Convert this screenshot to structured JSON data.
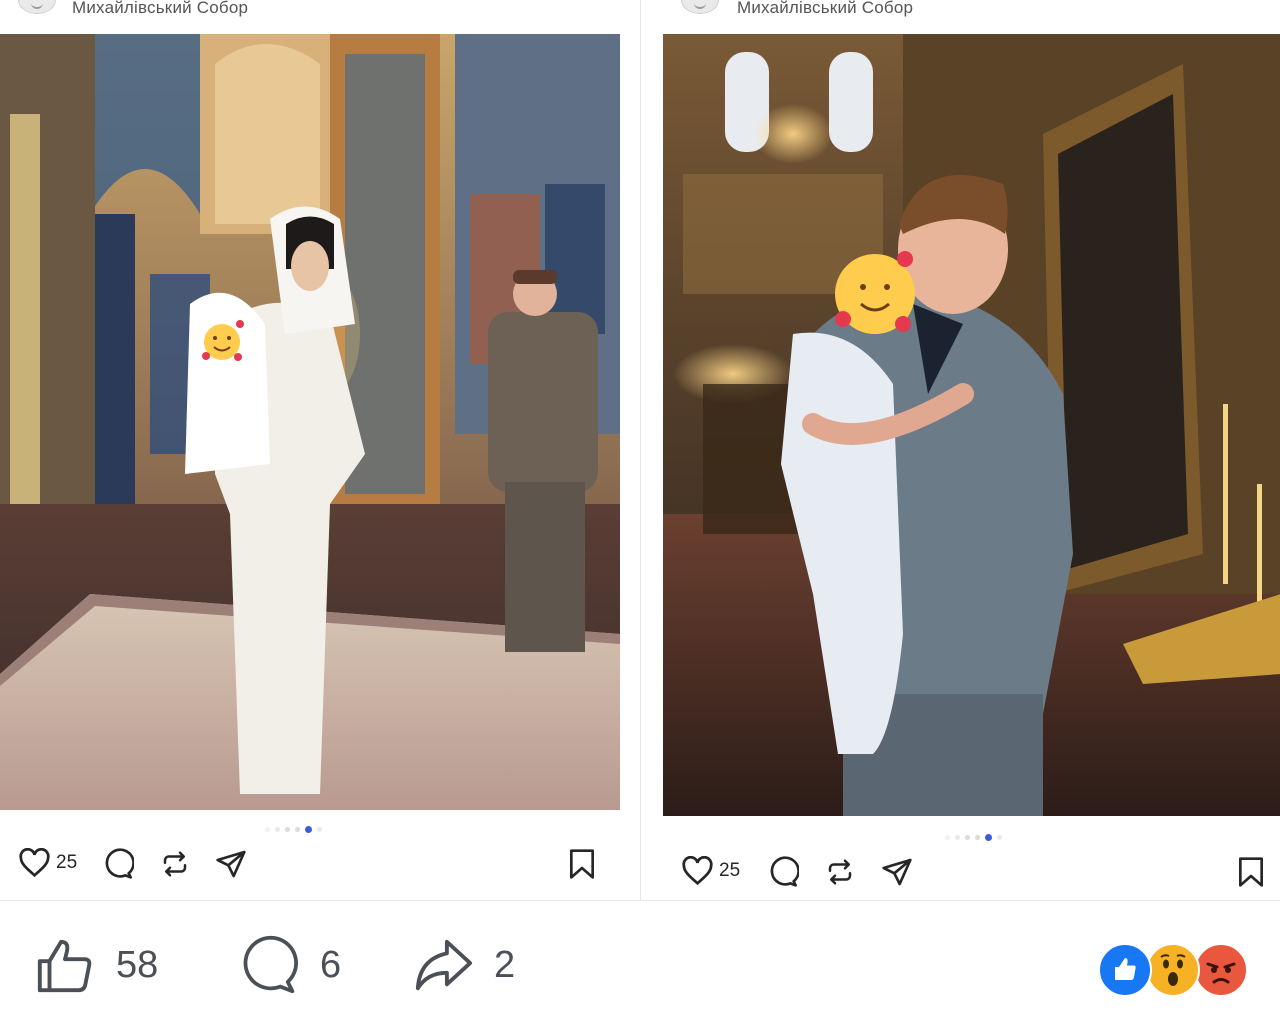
{
  "screenshot": {
    "posts": [
      {
        "account_name": "Михайлівський Собор",
        "photo_alt": "Woman in white holding baby in cathedral",
        "carousel": {
          "total": 6,
          "active_index": 4
        },
        "likes": "25",
        "icons": [
          "heart-icon",
          "comment-icon",
          "repost-icon",
          "share-icon",
          "bookmark-icon"
        ]
      },
      {
        "account_name": "Михайлівський Собор",
        "photo_alt": "Man in grey suit holding baby in cathedral",
        "carousel": {
          "total": 6,
          "active_index": 4
        },
        "likes": "25",
        "icons": [
          "heart-icon",
          "comment-icon",
          "repost-icon",
          "share-icon",
          "bookmark-icon"
        ]
      }
    ]
  },
  "facebook_bar": {
    "like_count": "58",
    "comment_count": "6",
    "share_count": "2",
    "reactions": [
      "like",
      "wow",
      "angry"
    ],
    "colors": {
      "like": "#1877f2",
      "wow": "#f7b125",
      "angry": "#e9573f",
      "text": "#4b4f56"
    }
  },
  "colors": {
    "active_dot": "#3e5bd8",
    "inactive_dot": "#dbdbdb"
  }
}
